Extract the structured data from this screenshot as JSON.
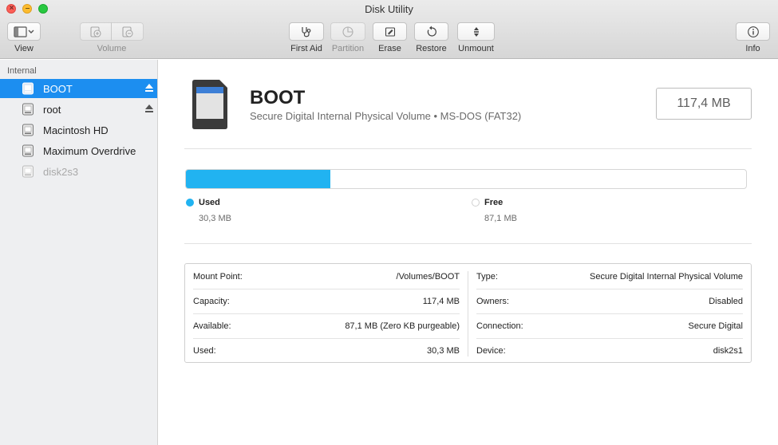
{
  "window": {
    "title": "Disk Utility"
  },
  "toolbar": {
    "view_label": "View",
    "volume_label": "Volume",
    "first_aid_label": "First Aid",
    "partition_label": "Partition",
    "erase_label": "Erase",
    "restore_label": "Restore",
    "unmount_label": "Unmount",
    "info_label": "Info"
  },
  "sidebar": {
    "header": "Internal",
    "items": [
      {
        "label": "BOOT",
        "selected": true,
        "eject": true
      },
      {
        "label": "root",
        "selected": false,
        "eject": true
      },
      {
        "label": "Macintosh HD",
        "selected": false,
        "eject": false
      },
      {
        "label": "Maximum Overdrive",
        "selected": false,
        "eject": false
      },
      {
        "label": "disk2s3",
        "selected": false,
        "eject": false,
        "dimmed": true
      }
    ]
  },
  "volume": {
    "name": "BOOT",
    "subtitle": "Secure Digital Internal Physical Volume • MS-DOS (FAT32)",
    "size": "117,4 MB"
  },
  "usage": {
    "used_fraction": 0.258,
    "used_label": "Used",
    "used_value": "30,3 MB",
    "free_label": "Free",
    "free_value": "87,1 MB",
    "used_color": "#21b3f1",
    "free_color": "#ffffff"
  },
  "info": {
    "left": [
      {
        "key": "Mount Point:",
        "value": "/Volumes/BOOT"
      },
      {
        "key": "Capacity:",
        "value": "117,4 MB"
      },
      {
        "key": "Available:",
        "value": "87,1 MB (Zero KB purgeable)"
      },
      {
        "key": "Used:",
        "value": "30,3 MB"
      }
    ],
    "right": [
      {
        "key": "Type:",
        "value": "Secure Digital Internal Physical Volume"
      },
      {
        "key": "Owners:",
        "value": "Disabled"
      },
      {
        "key": "Connection:",
        "value": "Secure Digital"
      },
      {
        "key": "Device:",
        "value": "disk2s1"
      }
    ]
  },
  "colors": {
    "selection": "#1c8ef0",
    "accent_used": "#21b3f1"
  }
}
